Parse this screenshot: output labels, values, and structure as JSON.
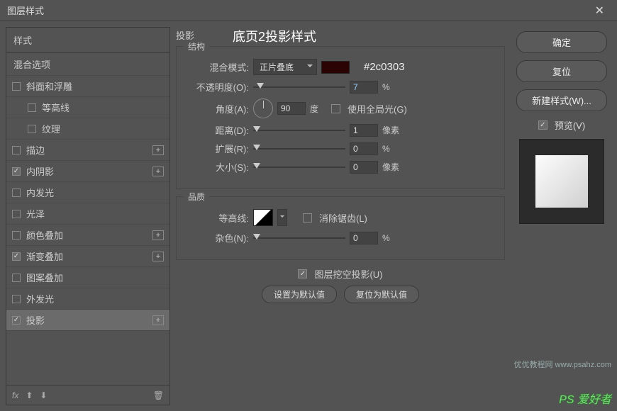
{
  "window": {
    "title": "图层样式",
    "close": "✕"
  },
  "annotation": "底页2投影样式",
  "sidebar": {
    "header": "样式",
    "blending": "混合选项",
    "items": [
      {
        "label": "斜面和浮雕",
        "checked": false,
        "plus": false
      },
      {
        "label": "等高线",
        "checked": false,
        "child": true
      },
      {
        "label": "纹理",
        "checked": false,
        "child": true
      },
      {
        "label": "描边",
        "checked": false,
        "plus": true
      },
      {
        "label": "内阴影",
        "checked": true,
        "plus": true
      },
      {
        "label": "内发光",
        "checked": false
      },
      {
        "label": "光泽",
        "checked": false
      },
      {
        "label": "颜色叠加",
        "checked": false,
        "plus": true
      },
      {
        "label": "渐变叠加",
        "checked": true,
        "plus": true
      },
      {
        "label": "图案叠加",
        "checked": false
      },
      {
        "label": "外发光",
        "checked": false
      },
      {
        "label": "投影",
        "checked": true,
        "plus": true,
        "selected": true
      }
    ],
    "footer": {
      "fx": "fx",
      "trash": "🗑"
    }
  },
  "settings": {
    "title": "投影",
    "structure": {
      "legend": "结构",
      "blend_label": "混合模式:",
      "blend_value": "正片叠底",
      "hex": "#2c0303",
      "opacity_label": "不透明度(O):",
      "opacity_value": "7",
      "opacity_unit": "%",
      "angle_label": "角度(A):",
      "angle_value": "90",
      "angle_unit": "度",
      "global_label": "使用全局光(G)",
      "distance_label": "距离(D):",
      "distance_value": "1",
      "distance_unit": "像素",
      "spread_label": "扩展(R):",
      "spread_value": "0",
      "spread_unit": "%",
      "size_label": "大小(S):",
      "size_value": "0",
      "size_unit": "像素"
    },
    "quality": {
      "legend": "品质",
      "contour_label": "等高线:",
      "antialias_label": "消除锯齿(L)",
      "noise_label": "杂色(N):",
      "noise_value": "0",
      "noise_unit": "%"
    },
    "knockout_label": "图层挖空投影(U)",
    "btn_default": "设置为默认值",
    "btn_reset": "复位为默认值"
  },
  "right": {
    "ok": "确定",
    "cancel": "复位",
    "newstyle": "新建样式(W)...",
    "preview": "预览(V)"
  },
  "watermark": {
    "main": "PS 爱好者",
    "sub": "优优教程网  www.psahz.com"
  }
}
